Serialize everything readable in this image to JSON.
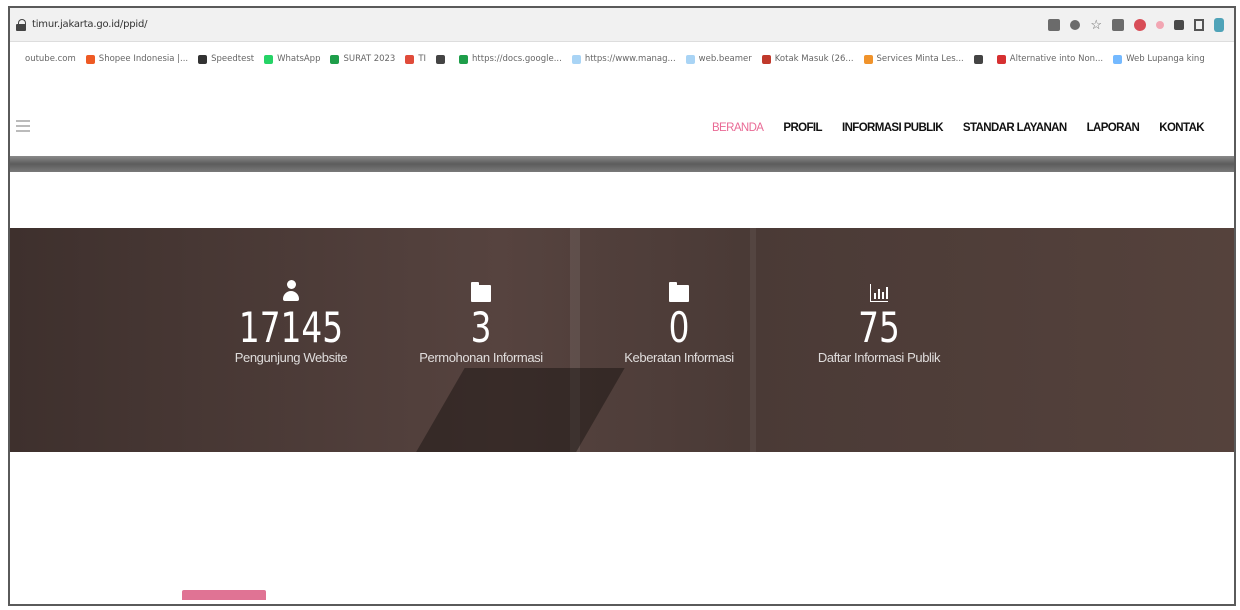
{
  "browser": {
    "url": "timur.jakarta.go.id/ppid/"
  },
  "bookmarks": [
    {
      "label": "outube.com",
      "color": "#ffffff"
    },
    {
      "label": "Shopee Indonesia |...",
      "color": "#ee5a24"
    },
    {
      "label": "Speedtest",
      "color": "#333333"
    },
    {
      "label": "WhatsApp",
      "color": "#25d366"
    },
    {
      "label": "SURAT 2023",
      "color": "#1e9e4a"
    },
    {
      "label": "TI",
      "color": "#e04b3a"
    },
    {
      "label": "",
      "color": "#444444"
    },
    {
      "label": "https://docs.google...",
      "color": "#1e9e4a"
    },
    {
      "label": "https://www.manag...",
      "color": "#a9d4f5"
    },
    {
      "label": "web.beamer",
      "color": "#a9d4f5"
    },
    {
      "label": "Kotak Masuk (26...",
      "color": "#c0392b"
    },
    {
      "label": "Services Minta Les...",
      "color": "#f0932b"
    },
    {
      "label": "",
      "color": "#444444"
    },
    {
      "label": "Alternative into Non...",
      "color": "#d63031"
    },
    {
      "label": "Web Lupanga king",
      "color": "#74b9ff"
    }
  ],
  "nav": {
    "items": [
      {
        "label": "BERANDA",
        "active": true
      },
      {
        "label": "PROFIL",
        "active": false
      },
      {
        "label": "INFORMASI PUBLIK",
        "active": false
      },
      {
        "label": "STANDAR LAYANAN",
        "active": false
      },
      {
        "label": "LAPORAN",
        "active": false
      },
      {
        "label": "KONTAK",
        "active": false
      }
    ]
  },
  "stats": [
    {
      "icon": "user-icon",
      "value": "17145",
      "label": "Pengunjung Website"
    },
    {
      "icon": "folder-icon",
      "value": "3",
      "label": "Permohonan Informasi"
    },
    {
      "icon": "folder-icon",
      "value": "0",
      "label": "Keberatan Informasi"
    },
    {
      "icon": "bar-chart-icon",
      "value": "75",
      "label": "Daftar Informasi Publik"
    }
  ],
  "colors": {
    "accent": "#e96a95",
    "hero_bg": "#4a3a36"
  }
}
